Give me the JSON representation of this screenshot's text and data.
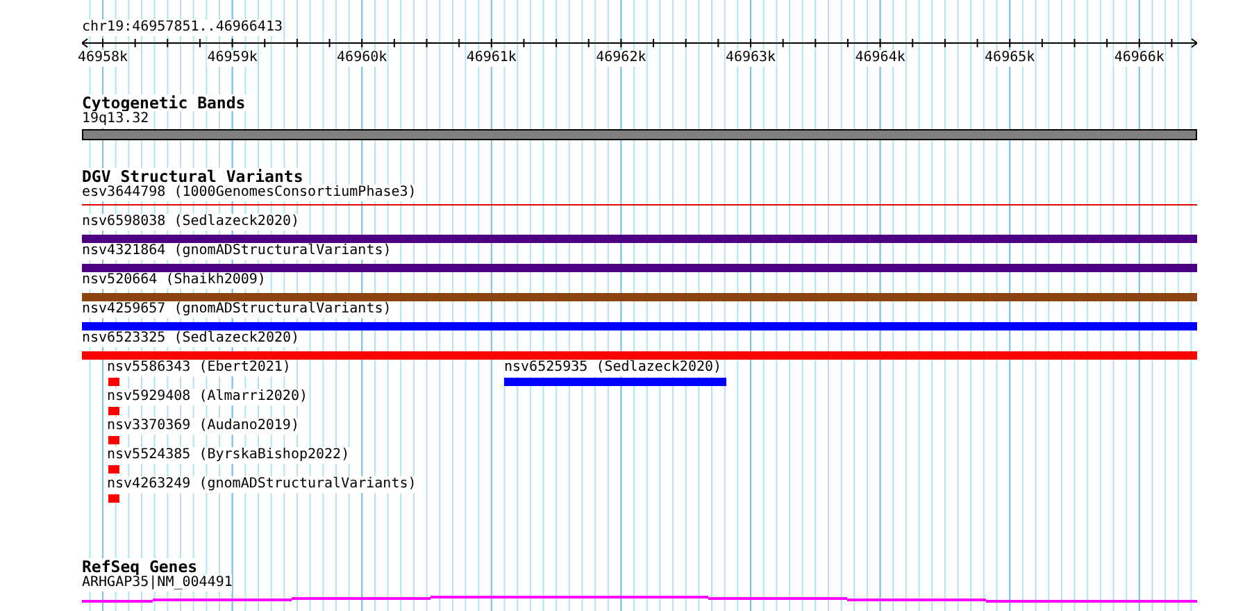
{
  "ruler": {
    "location": "chr19:46957851..46966413",
    "ticks": [
      "46958k",
      "46959k",
      "46960k",
      "46961k",
      "46962k",
      "46963k",
      "46964k",
      "46965k",
      "46966k"
    ]
  },
  "tracks": [
    {
      "kind": "bands",
      "title": "Cytogenetic Bands",
      "rows": [
        [
          {
            "label": "19q13.32",
            "kind": "band",
            "color": "#808080"
          }
        ]
      ]
    },
    {
      "kind": "variants",
      "title": "DGV Structural Variants",
      "rows": [
        [
          {
            "label": "esv3644798 (1000GenomesConsortiumPhase3)",
            "kind": "line",
            "color": "#e00000"
          }
        ],
        [
          {
            "label": "nsv6598038 (Sedlazeck2020)",
            "kind": "full",
            "color": "#4b0082"
          }
        ],
        [
          {
            "label": "nsv4321864 (gnomADStructuralVariants)",
            "kind": "full",
            "color": "#4b0082"
          }
        ],
        [
          {
            "label": "nsv520664 (Shaikh2009)",
            "kind": "full",
            "color": "#8b4513"
          }
        ],
        [
          {
            "label": "nsv4259657 (gnomADStructuralVariants)",
            "kind": "full",
            "color": "#0000ff"
          }
        ],
        [
          {
            "label": "nsv6523325 (Sedlazeck2020)",
            "kind": "full",
            "color": "#ff0000"
          }
        ],
        [
          {
            "label": "nsv5586343 (Ebert2021)",
            "kind": "point",
            "color": "#ff0000"
          },
          {
            "label": "nsv6525935 (Sedlazeck2020)",
            "kind": "segment",
            "color": "#0000ff"
          }
        ],
        [
          {
            "label": "nsv5929408 (Almarri2020)",
            "kind": "point",
            "color": "#ff0000"
          }
        ],
        [
          {
            "label": "nsv3370369 (Audano2019)",
            "kind": "point",
            "color": "#ff0000"
          }
        ],
        [
          {
            "label": "nsv5524385 (ByrskaBishop2022)",
            "kind": "point",
            "color": "#ff0000"
          }
        ],
        [
          {
            "label": "nsv4263249 (gnomADStructuralVariants)",
            "kind": "point",
            "color": "#ff0000"
          }
        ]
      ]
    },
    {
      "kind": "genes",
      "title": "RefSeq Genes",
      "rows": [
        [
          {
            "label": "ARHGAP35|NM_004491",
            "kind": "gene",
            "color": "#ff00ff"
          }
        ]
      ]
    }
  ]
}
